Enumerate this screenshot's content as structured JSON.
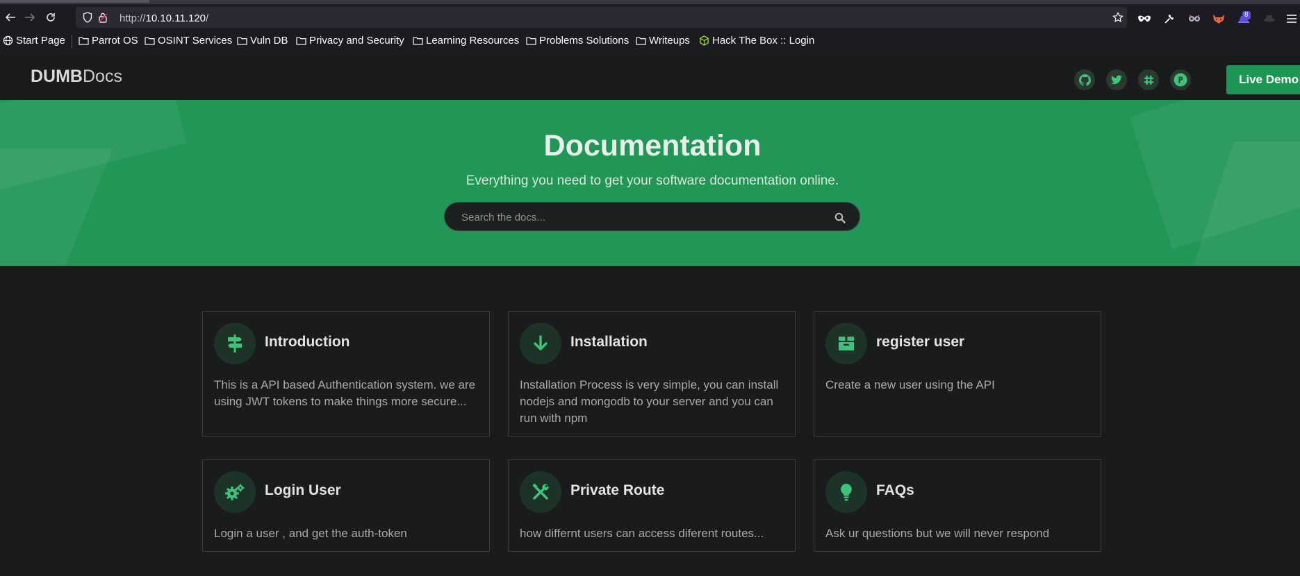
{
  "browser": {
    "url_prefix": "http://",
    "url_host": "10.10.11.120",
    "url_suffix": "/",
    "extension_badge": "8",
    "bookmarks": [
      {
        "label": "Start Page",
        "icon": "globe-icon"
      },
      {
        "label": "Parrot OS",
        "icon": "folder-icon"
      },
      {
        "label": "OSINT Services",
        "icon": "folder-icon"
      },
      {
        "label": "Vuln DB",
        "icon": "folder-icon"
      },
      {
        "label": "Privacy and Security",
        "icon": "folder-icon"
      },
      {
        "label": "Learning Resources",
        "icon": "folder-icon"
      },
      {
        "label": "Problems Solutions",
        "icon": "folder-icon"
      },
      {
        "label": "Writeups",
        "icon": "folder-icon"
      },
      {
        "label": "Hack The Box :: Login",
        "icon": "htb-cube-icon"
      }
    ]
  },
  "site": {
    "logo_bold": "DUMB",
    "logo_light": "Docs",
    "social": [
      "github-icon",
      "twitter-icon",
      "slack-icon",
      "product-hunt-icon"
    ],
    "live_demo_label": "Live Demo",
    "accent": "#219657"
  },
  "hero": {
    "title": "Documentation",
    "subtitle": "Everything you need to get your software documentation online.",
    "search_placeholder": "Search the docs..."
  },
  "cards": [
    {
      "title": "Introduction",
      "icon": "signpost-icon",
      "desc": "This is a API based Authentication system. we are using JWT tokens to make things more secure..."
    },
    {
      "title": "Installation",
      "icon": "arrow-down-icon",
      "desc": "Installation Process is very simple, you can install nodejs and mongodb to your server and you can run with npm"
    },
    {
      "title": "register user",
      "icon": "box-icon",
      "desc": "Create a new user using the API"
    },
    {
      "title": "Login User",
      "icon": "cogs-icon",
      "desc": "Login a user , and get the auth-token"
    },
    {
      "title": "Private Route",
      "icon": "tools-icon",
      "desc": "how differnt users can access diferent routes..."
    },
    {
      "title": "FAQs",
      "icon": "lightbulb-icon",
      "desc": "Ask ur questions but we will never respond"
    }
  ]
}
